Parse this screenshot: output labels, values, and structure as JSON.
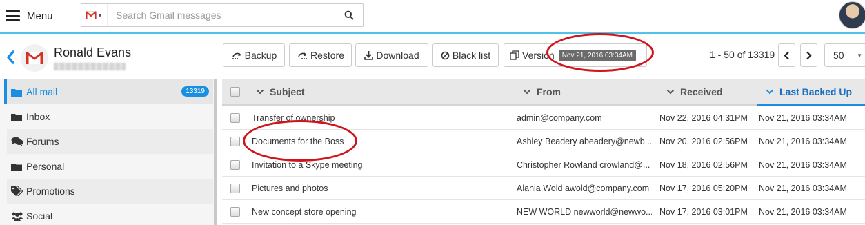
{
  "topbar": {
    "menu_label": "Menu",
    "search_placeholder": "Search Gmail messages",
    "accent_color": "#4fc3e8"
  },
  "account": {
    "name": "Ronald Evans"
  },
  "toolbar": {
    "backup": "Backup",
    "restore": "Restore",
    "download": "Download",
    "blacklist": "Black list",
    "version_label": "Version",
    "version_value": "Nov 21, 2016 03:34AM"
  },
  "pager": {
    "range": "1 - 50 of 13319",
    "per_page": "50"
  },
  "sidebar": {
    "items": [
      {
        "label": "All mail",
        "icon": "folder-icon",
        "count": "13319"
      },
      {
        "label": "Inbox",
        "icon": "folder-icon"
      },
      {
        "label": "Forums",
        "icon": "comments-icon"
      },
      {
        "label": "Personal",
        "icon": "folder-icon"
      },
      {
        "label": "Promotions",
        "icon": "tags-icon"
      },
      {
        "label": "Social",
        "icon": "users-icon"
      }
    ]
  },
  "table": {
    "columns": [
      "Subject",
      "From",
      "Received",
      "Last Backed Up"
    ],
    "rows": [
      {
        "subject": "Transfer of ownership",
        "from": "admin@company.com",
        "received": "Nov 22, 2016 04:31PM",
        "backed_up": "Nov 21, 2016 03:34AM"
      },
      {
        "subject": "Documents for the Boss",
        "from": "Ashley Beadery abeadery@newb...",
        "received": "Nov 20, 2016 02:56PM",
        "backed_up": "Nov 21, 2016 03:34AM"
      },
      {
        "subject": "Invitation to a Skype meeting",
        "from": "Christopher Rowland crowland@...",
        "received": "Nov 18, 2016 02:56PM",
        "backed_up": "Nov 21, 2016 03:34AM"
      },
      {
        "subject": "Pictures and photos",
        "from": "Alania Wold awold@company.com",
        "received": "Nov 17, 2016 05:20PM",
        "backed_up": "Nov 21, 2016 03:34AM"
      },
      {
        "subject": "New concept store opening",
        "from": "NEW WORLD newworld@newwo...",
        "received": "Nov 17, 2016 03:01PM",
        "backed_up": "Nov 21, 2016 03:34AM"
      }
    ]
  },
  "colors": {
    "highlight_oval": "#d0141c",
    "active_blue": "#1a8ee1"
  }
}
